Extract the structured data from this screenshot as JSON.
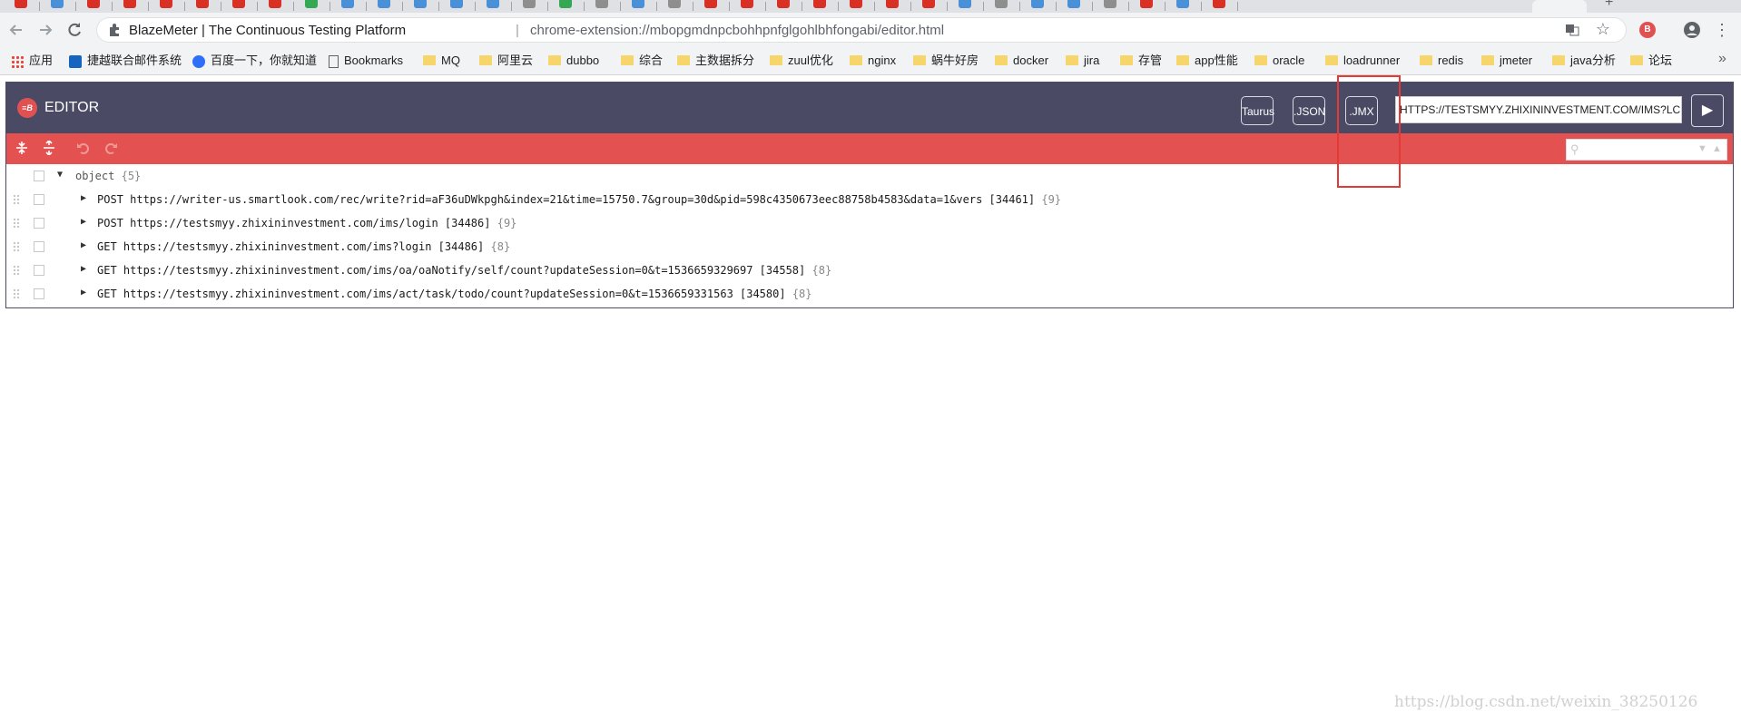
{
  "colors": {
    "editor_header": "#4a4a64",
    "editor_toolbar": "#e35250",
    "highlight": "#e53935",
    "folder": "#f6d66b"
  },
  "tabs": {
    "favicon_colors": [
      "#d93025",
      "#4a90d9",
      "#d93025",
      "#d93025",
      "#d93025",
      "#d93025",
      "#d93025",
      "#d93025",
      "#34a853",
      "#4a90d9",
      "#4a90d9",
      "#4a90d9",
      "#4a90d9",
      "#4a90d9",
      "#8e8e8e",
      "#34a853",
      "#8e8e8e",
      "#4a90d9",
      "#8e8e8e",
      "#d93025",
      "#d93025",
      "#d93025",
      "#d93025",
      "#d93025",
      "#d93025",
      "#d93025",
      "#4a90d9",
      "#8e8e8e",
      "#4a90d9",
      "#4a90d9",
      "#8e8e8e",
      "#d93025",
      "#4a90d9",
      "#d93025"
    ],
    "new_tab": "+"
  },
  "browser": {
    "back_icon": "back-arrow-icon",
    "forward_icon": "forward-arrow-icon",
    "reload_icon": "reload-icon",
    "page_title": "BlazeMeter | The Continuous Testing Platform",
    "divider": "|",
    "url": "chrome-extension://mbopgmdnpcbohhpnfglgohlbhfongabi/editor.html",
    "extension_label": "B"
  },
  "bookmarks": [
    {
      "label": "应用",
      "icon": "apps-icon"
    },
    {
      "label": "捷越联合邮件系统",
      "icon": "site-icon"
    },
    {
      "label": "百度一下，你就知道",
      "icon": "baidu-icon"
    },
    {
      "label": "Bookmarks",
      "icon": "page-icon"
    },
    {
      "label": "MQ",
      "icon": "folder-icon"
    },
    {
      "label": "阿里云",
      "icon": "folder-icon"
    },
    {
      "label": "dubbo",
      "icon": "folder-icon"
    },
    {
      "label": "综合",
      "icon": "folder-icon"
    },
    {
      "label": "主数据拆分",
      "icon": "folder-icon"
    },
    {
      "label": "zuul优化",
      "icon": "folder-icon"
    },
    {
      "label": "nginx",
      "icon": "folder-icon"
    },
    {
      "label": "蜗牛好房",
      "icon": "folder-icon"
    },
    {
      "label": "docker",
      "icon": "folder-icon"
    },
    {
      "label": "jira",
      "icon": "folder-icon"
    },
    {
      "label": "存管",
      "icon": "folder-icon"
    },
    {
      "label": "app性能",
      "icon": "folder-icon"
    },
    {
      "label": "oracle",
      "icon": "folder-icon"
    },
    {
      "label": "loadrunner",
      "icon": "folder-icon"
    },
    {
      "label": "redis",
      "icon": "folder-icon"
    },
    {
      "label": "jmeter",
      "icon": "folder-icon"
    },
    {
      "label": "java分析",
      "icon": "folder-icon"
    },
    {
      "label": "论坛",
      "icon": "folder-icon"
    }
  ],
  "editor": {
    "logo_text": "≡B",
    "title": "EDITOR",
    "buttons": {
      "taurus": "Taurus",
      "json": ".JSON",
      "jmx": ".JMX"
    },
    "url_value": "HTTPS://TESTSMYY.ZHIXININVESTMENT.COM/IMS?LC",
    "play_icon": "▶",
    "toolbar_icons": [
      "collapse-all-icon",
      "expand-all-icon",
      "undo-icon",
      "redo-icon"
    ],
    "search_placeholder": ""
  },
  "tree": {
    "root": {
      "label": "object",
      "count": "{5}"
    },
    "rows": [
      {
        "label": "POST https://writer-us.smartlook.com/rec/write?rid=aF36uDWkpgh&index=21&time=15750.7&group=30d&pid=598c4350673eec88758b4583&data=1&vers [34461]",
        "count": "{9}"
      },
      {
        "label": "POST https://testsmyy.zhixininvestment.com/ims/login [34486]",
        "count": "{9}"
      },
      {
        "label": "GET https://testsmyy.zhixininvestment.com/ims?login [34486]",
        "count": "{8}"
      },
      {
        "label": "GET https://testsmyy.zhixininvestment.com/ims/oa/oaNotify/self/count?updateSession=0&t=1536659329697 [34558]",
        "count": "{8}"
      },
      {
        "label": "GET https://testsmyy.zhixininvestment.com/ims/act/task/todo/count?updateSession=0&t=1536659331563 [34580]",
        "count": "{8}"
      }
    ]
  },
  "watermark": "https://blog.csdn.net/weixin_38250126"
}
